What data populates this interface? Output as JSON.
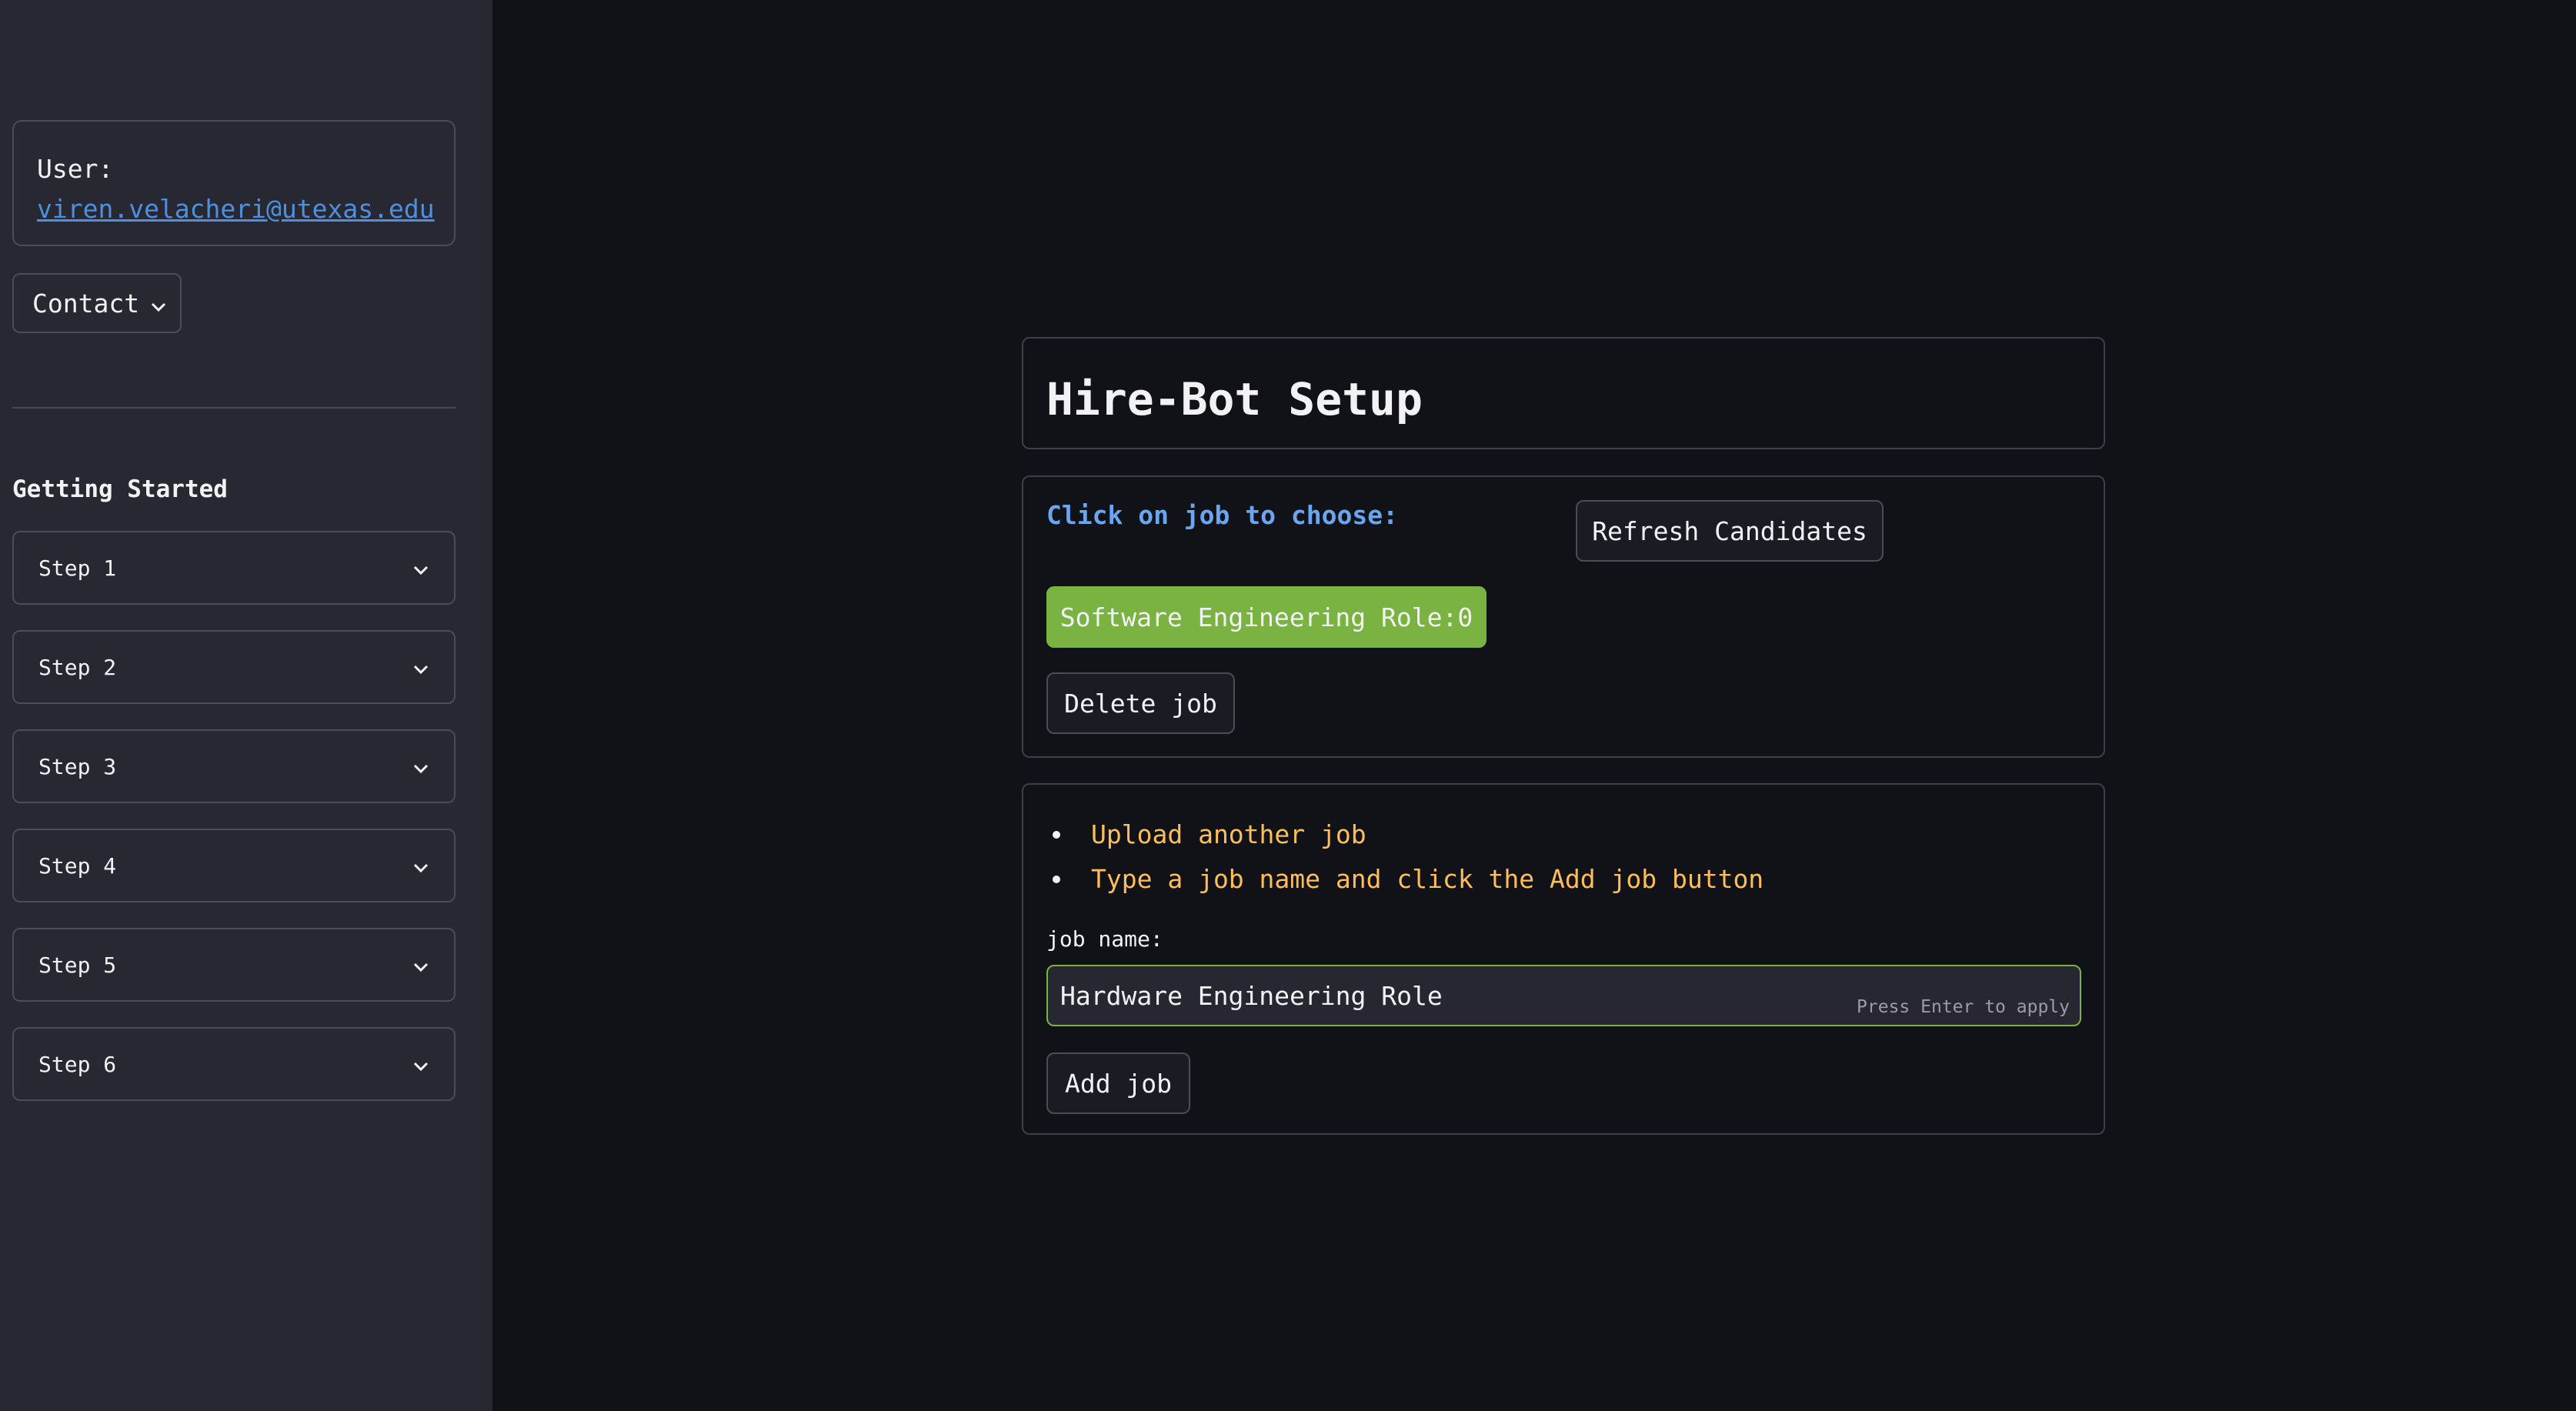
{
  "sidebar": {
    "user_label": "User:",
    "user_email": "viren.velacheri@utexas.edu",
    "contact_label": "Contact",
    "section_title": "Getting Started",
    "steps": [
      {
        "label": "Step 1"
      },
      {
        "label": "Step 2"
      },
      {
        "label": "Step 3"
      },
      {
        "label": "Step 4"
      },
      {
        "label": "Step 5"
      },
      {
        "label": "Step 6"
      }
    ]
  },
  "main": {
    "title": "Hire-Bot Setup",
    "choose_label": "Click on job to choose:",
    "refresh_label": "Refresh Candidates",
    "jobs": [
      {
        "label": "Software Engineering Role:0"
      }
    ],
    "delete_label": "Delete job",
    "instructions": [
      "Upload another job",
      "Type a job name and click the Add job button"
    ],
    "job_name_label": "job name:",
    "job_name_value": "Hardware Engineering Role",
    "enter_hint": "Press Enter to apply",
    "add_label": "Add job"
  },
  "colors": {
    "sidebar_bg": "#272831",
    "main_bg": "#111218",
    "accent_green": "#7ab342",
    "link_blue": "#4f8fe0",
    "label_blue": "#6aa5f0",
    "instruction_orange": "#ffbe5c"
  },
  "icons": {
    "contact_chevron": "chevron-down-icon",
    "step_chevron": "chevron-down-icon"
  }
}
